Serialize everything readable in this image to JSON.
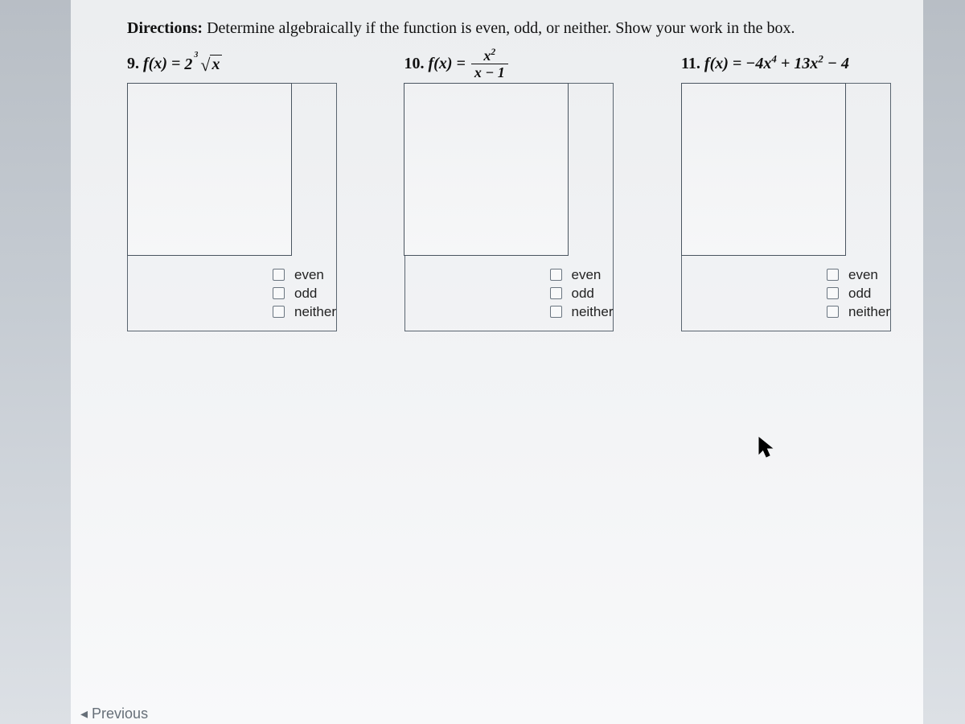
{
  "directions_label": "Directions:",
  "directions_text": "Determine algebraically if the function is even, odd, or neither. Show your work in the box.",
  "problems": [
    {
      "number": "9.",
      "func_lhs": "f(x) =",
      "expr_plain": "2∛x",
      "options": [
        "even",
        "odd",
        "neither"
      ]
    },
    {
      "number": "10.",
      "func_lhs": "f(x) =",
      "frac_num": "x²",
      "frac_den": "x − 1",
      "options": [
        "even",
        "odd",
        "neither"
      ]
    },
    {
      "number": "11.",
      "func_lhs": "f(x) =",
      "expr_plain": "−4x⁴ + 13x² − 4",
      "options": [
        "even",
        "odd",
        "neither"
      ]
    }
  ],
  "nav": {
    "previous": "◂ Previous"
  }
}
